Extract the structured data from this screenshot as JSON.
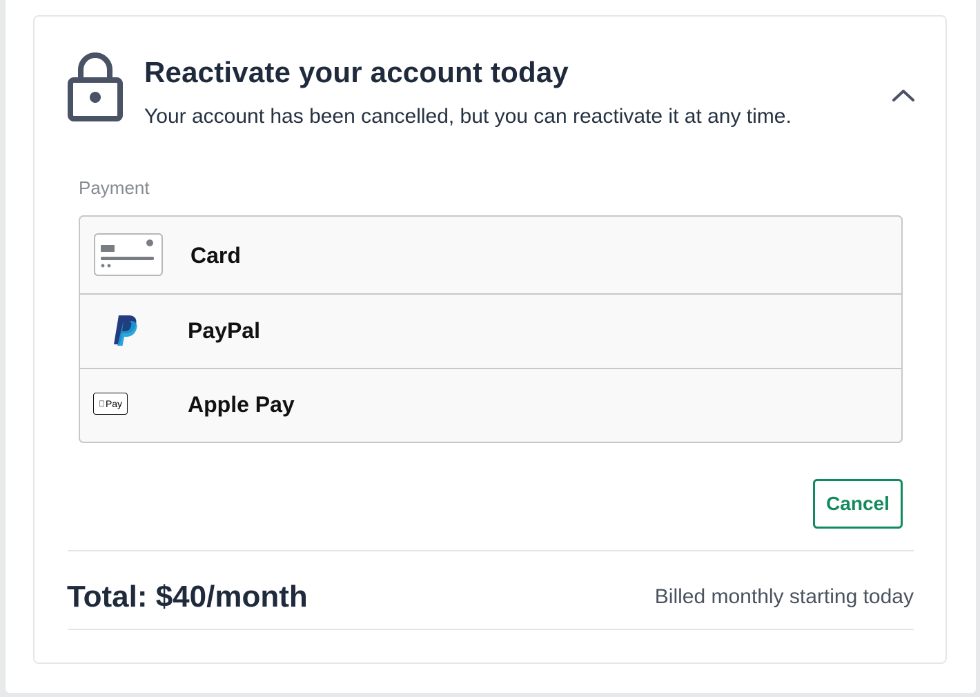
{
  "header": {
    "title": "Reactivate your account today",
    "subtitle": "Your account has been cancelled, but you can reactivate it at any time.",
    "lock_icon": "lock-icon",
    "collapse_icon": "chevron-up-icon"
  },
  "payment": {
    "label": "Payment",
    "methods": [
      {
        "label": "Card",
        "icon": "credit-card-icon"
      },
      {
        "label": "PayPal",
        "icon": "paypal-logo-icon"
      },
      {
        "label": "Apple Pay",
        "icon": "apple-pay-logo-icon",
        "icon_text": "Pay"
      }
    ]
  },
  "actions": {
    "cancel_label": "Cancel"
  },
  "summary": {
    "total": "Total: $40/month",
    "billing_note": "Billed monthly starting today"
  },
  "colors": {
    "heading": "#1f2a3d",
    "accent_green": "#138a5d",
    "muted_label": "#858b93",
    "border": "#c5c8cc",
    "paypal_dark": "#253b80",
    "paypal_light": "#179bd7"
  }
}
